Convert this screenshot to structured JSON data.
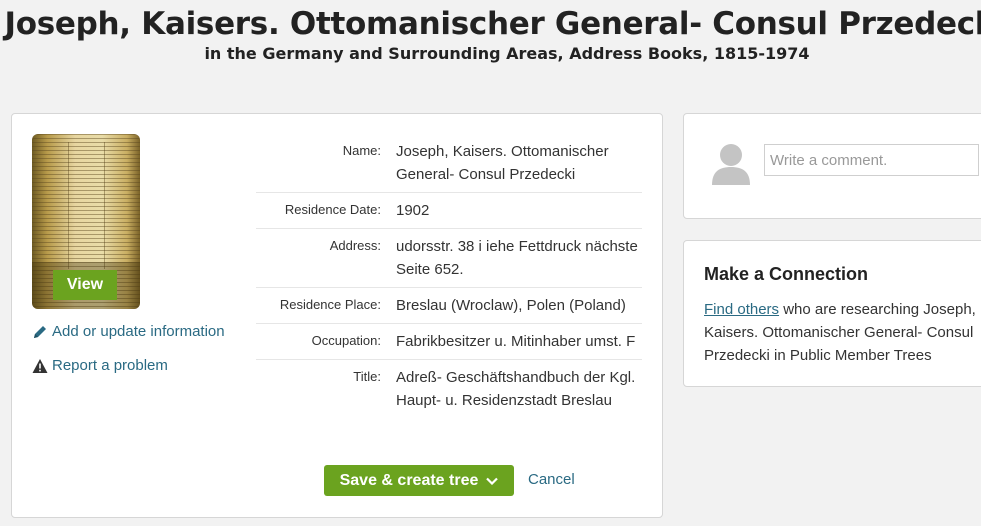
{
  "header": {
    "title": "Joseph, Kaisers. Ottomanischer General- Consul Przedecki",
    "subtitle": "in the Germany and Surrounding Areas, Address Books, 1815-1974"
  },
  "record": {
    "view_label": "View",
    "edit_link": "Add or update information",
    "report_link": "Report a problem",
    "facts": [
      {
        "label": "Name:",
        "value": "Joseph, Kaisers. Ottomanischer General- Consul Przedecki"
      },
      {
        "label": "Residence Date:",
        "value": "1902"
      },
      {
        "label": "Address:",
        "value": "udorsstr. 38 i iehe Fettdruck nächste Seite 652."
      },
      {
        "label": "Residence Place:",
        "value": "Breslau (Wroclaw), Polen (Poland)"
      },
      {
        "label": "Occupation:",
        "value": "Fabrikbesitzer u. Mitinhaber umst. F"
      },
      {
        "label": "Title:",
        "value": "Adreß- Geschäftshandbuch der Kgl. Haupt- u. Residenzstadt Breslau"
      }
    ],
    "save_label": "Save & create tree",
    "cancel_label": "Cancel"
  },
  "comment": {
    "placeholder": "Write a comment."
  },
  "connection": {
    "title": "Make a Connection",
    "link_text": "Find others",
    "text": " who are researching Joseph, Kaisers. Ottomanischer General- Consul Przedecki in Public Member Trees"
  },
  "icons": {
    "edit": "pencil-icon",
    "report": "warning-icon",
    "dropdown": "chevron-down-icon",
    "avatar": "user-silhouette-icon"
  },
  "colors": {
    "accent_green": "#6ba31f",
    "link": "#2a6a83",
    "background": "#f2f2f2"
  }
}
